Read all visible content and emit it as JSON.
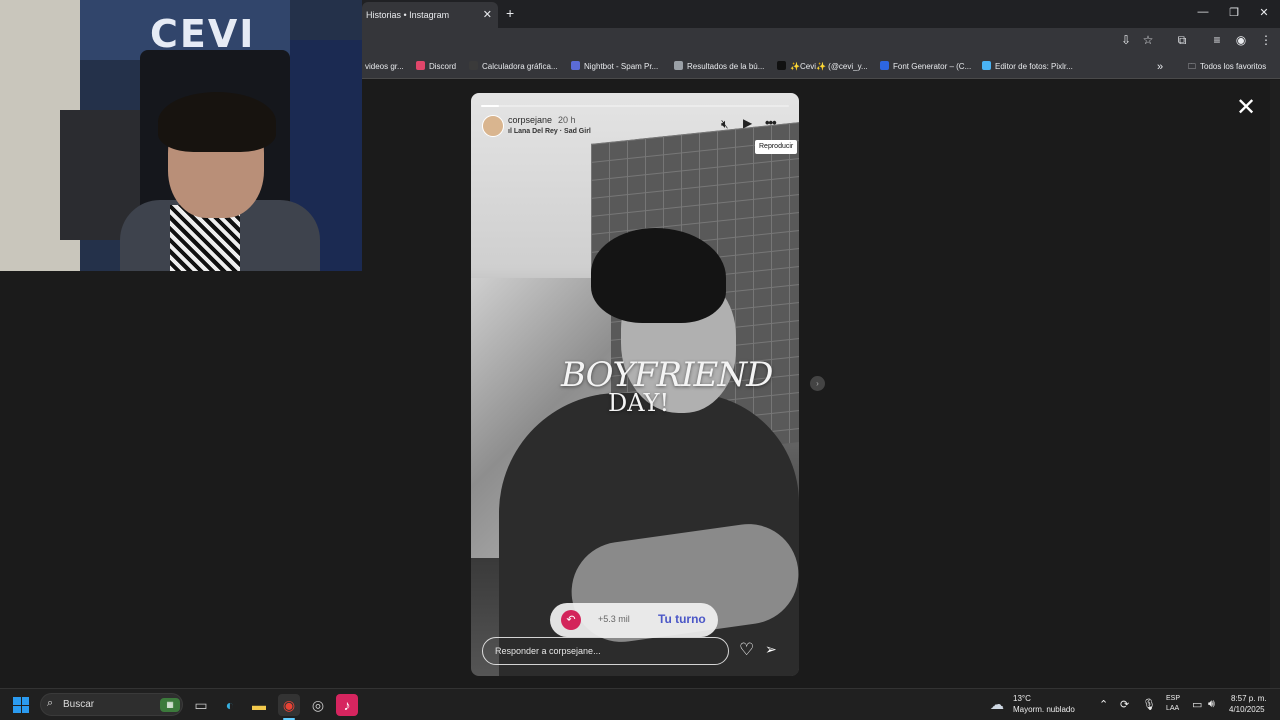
{
  "browser": {
    "active_tab_title": "Historias • Instagram",
    "tab_close_glyph": "✕",
    "new_tab_glyph": "+",
    "window_controls": [
      "—",
      "❐",
      "✕"
    ],
    "toolbar_icons": [
      "install-icon",
      "star-icon",
      "extensions-icon",
      "media-icon",
      "profile-icon",
      "kebab-menu-icon"
    ],
    "bookmarks": [
      {
        "label": "videos gr..."
      },
      {
        "label": "Discord",
        "icon_color": "#e0466a"
      },
      {
        "label": "Calculadora gráfica...",
        "icon_color": "#3a3a3a"
      },
      {
        "label": "Nightbot - Spam Pr...",
        "icon_color": "#5b6bd6"
      },
      {
        "label": "Resultados de la bú...",
        "icon_color": "#9aa0a6"
      },
      {
        "label": "✨Cevi✨ (@cevi_y...",
        "icon_color": "#111111"
      },
      {
        "label": "Font Generator – (C...",
        "icon_color": "#2d66e0"
      },
      {
        "label": "Editor de fotos: Pixlr...",
        "icon_color": "#4ab3f4"
      }
    ],
    "bookmarks_overflow": "»",
    "all_bookmarks": "Todos los favoritos"
  },
  "webcam": {
    "banner_text": "CEVI"
  },
  "story": {
    "username": "corpsejane",
    "time_ago": "20 h",
    "music": "Lana Del Rey · Sad Girl",
    "progress_fraction": 0.06,
    "tooltip": "Reproducir",
    "sticker_line1": "BOYFRIEND",
    "sticker_line2": "DAY!",
    "turn": {
      "count": "+5.3 mil",
      "label": "Tu turno"
    },
    "reply_placeholder": "Responder a corpsejane...",
    "close_glyph": "✕",
    "next_glyph": "›"
  },
  "taskbar": {
    "search_label": "Buscar",
    "apps": [
      "photos-app",
      "desktop-app",
      "edge-app",
      "file-explorer-app",
      "chrome-app",
      "obs-app",
      "tiktok-app"
    ],
    "weather": {
      "temp": "13°C",
      "description": "Mayorm. nublado"
    },
    "language": [
      "ESP",
      "LAA"
    ],
    "time": "8:57 p. m.",
    "date": "4/10/2025"
  },
  "colors": {
    "instagram_accent": "#4b57c7",
    "turn_icon": "#d3245a",
    "windows_blue": "#2b9bf0"
  }
}
